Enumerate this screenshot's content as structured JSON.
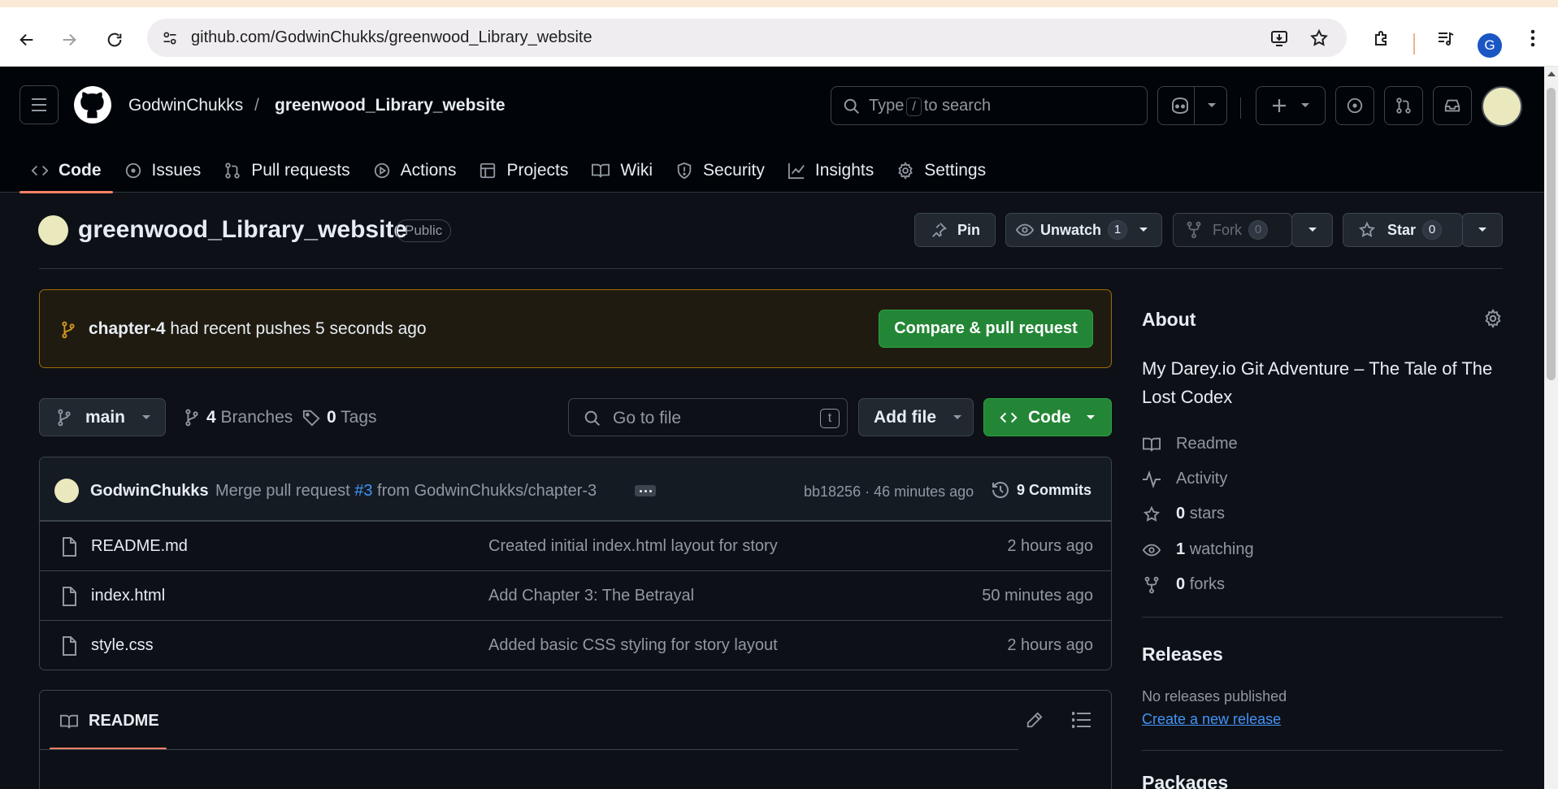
{
  "browser": {
    "url": "github.com/GodwinChukks/greenwood_Library_website",
    "profile_initial": "G"
  },
  "header": {
    "owner": "GodwinChukks",
    "separator": "/",
    "repo": "greenwood_Library_website",
    "search_prefix": "Type",
    "search_key": "/",
    "search_suffix": "to search"
  },
  "tabs": [
    {
      "label": "Code",
      "icon": "code-icon",
      "active": true
    },
    {
      "label": "Issues",
      "icon": "issue-icon"
    },
    {
      "label": "Pull requests",
      "icon": "pull-request-icon"
    },
    {
      "label": "Actions",
      "icon": "play-icon"
    },
    {
      "label": "Projects",
      "icon": "table-icon"
    },
    {
      "label": "Wiki",
      "icon": "book-icon"
    },
    {
      "label": "Security",
      "icon": "shield-icon"
    },
    {
      "label": "Insights",
      "icon": "graph-icon"
    },
    {
      "label": "Settings",
      "icon": "gear-icon"
    }
  ],
  "repo_header": {
    "name": "greenwood_Library_website",
    "visibility": "Public",
    "pin_label": "Pin",
    "unwatch_label": "Unwatch",
    "watch_count": "1",
    "fork_label": "Fork",
    "fork_count": "0",
    "star_label": "Star",
    "star_count": "0"
  },
  "banner": {
    "branch": "chapter-4",
    "text": "had recent pushes 5 seconds ago",
    "button": "Compare & pull request",
    "accent": "#9e6a03"
  },
  "branch_bar": {
    "branch": "main",
    "branches_count": "4",
    "branches_label": "Branches",
    "tags_count": "0",
    "tags_label": "Tags",
    "goto_placeholder": "Go to file",
    "goto_key": "t",
    "add_file": "Add file",
    "code_button": "Code"
  },
  "latest_commit": {
    "author": "GodwinChukks",
    "msg_prefix": "Merge pull request",
    "pr": "#3",
    "msg_suffix": "from GodwinChukks/chapter-3",
    "sha_time": "bb18256 · 46 minutes ago",
    "commits_count": "9",
    "commits_label": "Commits"
  },
  "files": [
    {
      "name": "README.md",
      "commit": "Created initial index.html layout for story",
      "time": "2 hours ago"
    },
    {
      "name": "index.html",
      "commit": "Add Chapter 3: The Betrayal",
      "time": "50 minutes ago"
    },
    {
      "name": "style.css",
      "commit": "Added basic CSS styling for story layout",
      "time": "2 hours ago"
    }
  ],
  "readme": {
    "title": "README"
  },
  "about": {
    "title": "About",
    "description": "My Darey.io Git Adventure – The Tale of The Lost Codex",
    "readme": "Readme",
    "activity": "Activity",
    "stars_count": "0",
    "stars_label": "stars",
    "watching_count": "1",
    "watching_label": "watching",
    "forks_count": "0",
    "forks_label": "forks"
  },
  "releases": {
    "title": "Releases",
    "none": "No releases published",
    "create": "Create a new release"
  },
  "packages": {
    "title": "Packages"
  },
  "colors": {
    "bg": "#0d1117",
    "green": "#238636",
    "link": "#4493f8",
    "tab_underline": "#f78166"
  }
}
